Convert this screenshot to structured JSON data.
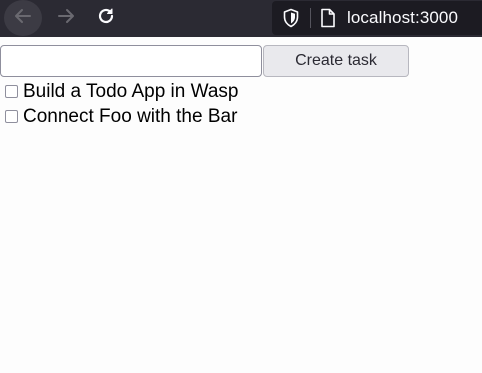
{
  "browser": {
    "url": "localhost:3000",
    "icons": {
      "back": "arrow-left-icon",
      "forward": "arrow-right-icon",
      "reload": "reload-icon",
      "tracking": "shield-icon",
      "page": "page-icon"
    }
  },
  "form": {
    "input_value": "",
    "submit_label": "Create task"
  },
  "tasks": [
    {
      "description": "Build a Todo App in Wasp",
      "done": false
    },
    {
      "description": "Connect Foo with the Bar",
      "done": false
    }
  ],
  "colors": {
    "toolbar_bg": "#2b2a33",
    "urlbar_bg": "#1c1b22",
    "button_bg": "#e9e9ed",
    "page_bg": "#fdfdfd"
  }
}
